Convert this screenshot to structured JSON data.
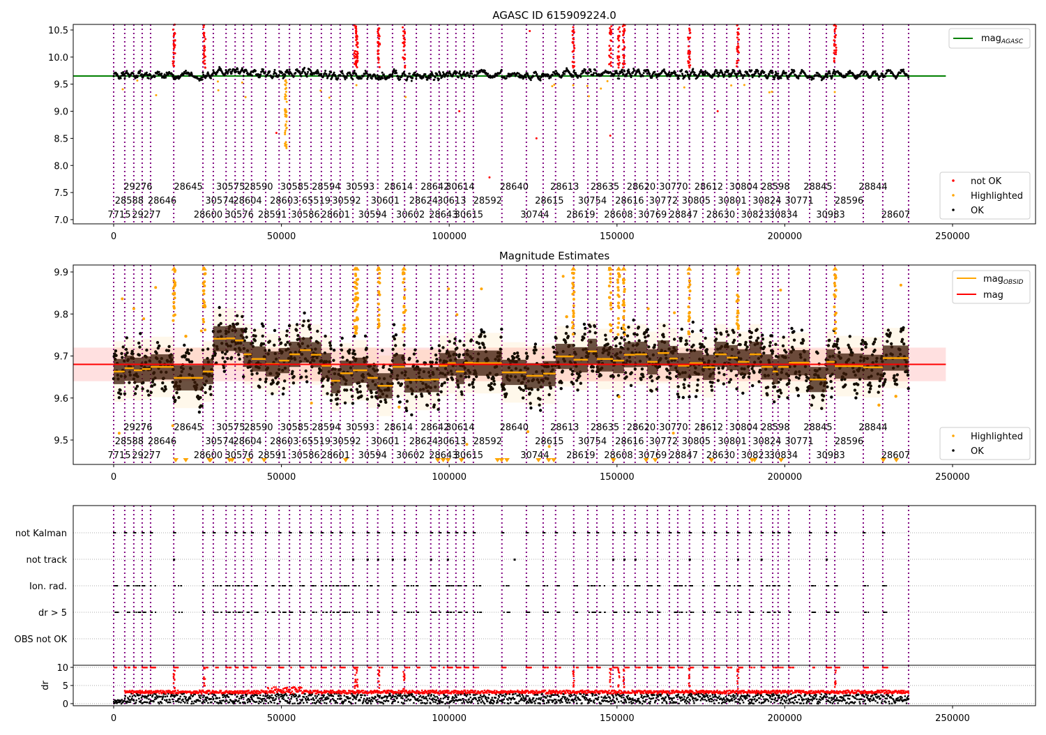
{
  "chart_data": {
    "type": "scatter",
    "titles": {
      "top": "AGASC ID 615909224.0",
      "middle": "Magnitude Estimates"
    },
    "xlim": [
      -12000,
      274700
    ],
    "xticks": [
      0,
      50000,
      100000,
      150000,
      200000,
      250000
    ],
    "obsids": [
      "7715",
      "28588",
      "29276",
      "29277",
      "28646",
      "28645",
      "28600",
      "30574",
      "30575",
      "30576",
      "28604",
      "28590",
      "28591",
      "28603",
      "30585",
      "30586",
      "65519",
      "28594",
      "28601",
      "30592",
      "30593",
      "30594",
      "30601",
      "28614",
      "30602",
      "28624",
      "28642",
      "28643",
      "30613",
      "30614",
      "30615",
      "28592",
      "28640",
      "30744",
      "28615",
      "28613",
      "28619",
      "30754",
      "28635",
      "28608",
      "28616",
      "28620",
      "30769",
      "30772",
      "30770",
      "28847",
      "30805",
      "28612",
      "28630",
      "30801",
      "30804",
      "30823",
      "30824",
      "28598",
      "30834",
      "30771",
      "28845",
      "30983",
      "28596",
      "28844",
      "28607"
    ],
    "obsid_start": [
      0,
      3300,
      6000,
      8500,
      11000,
      17900,
      26600,
      29700,
      33500,
      36200,
      38700,
      41100,
      45300,
      49300,
      52400,
      55500,
      58800,
      61900,
      64800,
      67500,
      71300,
      75600,
      78700,
      83100,
      86700,
      90200,
      94500,
      97000,
      99500,
      102000,
      104500,
      107200,
      115700,
      123000,
      128000,
      131700,
      137100,
      141300,
      144000,
      148800,
      152100,
      155400,
      159000,
      162100,
      165600,
      168100,
      171600,
      175600,
      179100,
      182700,
      186000,
      189500,
      193000,
      196400,
      198000,
      201200,
      207400,
      212400,
      214900,
      223400,
      229200
    ],
    "time_end": 236900,
    "mag_obsid": [
      9.663,
      9.671,
      9.666,
      9.669,
      9.674,
      9.648,
      9.663,
      9.741,
      9.742,
      9.737,
      9.704,
      9.693,
      9.681,
      9.689,
      9.704,
      9.714,
      9.703,
      9.677,
      9.641,
      9.659,
      9.666,
      9.648,
      9.629,
      9.674,
      9.643,
      9.643,
      9.644,
      9.677,
      9.683,
      9.663,
      9.684,
      9.683,
      9.661,
      9.653,
      9.658,
      9.699,
      9.691,
      9.711,
      9.693,
      9.689,
      9.703,
      9.704,
      9.686,
      9.707,
      9.694,
      9.677,
      9.683,
      9.673,
      9.704,
      9.696,
      9.686,
      9.704,
      9.674,
      9.663,
      9.674,
      9.684,
      9.644,
      9.686,
      9.676,
      9.673,
      9.695
    ],
    "mag_obsid_std": 0.04,
    "mag": 9.68,
    "mag_std": 0.04,
    "mag_agasc": 9.65,
    "not_ok_spike_times": [
      18000,
      27000,
      72000,
      72500,
      79000,
      86500,
      137000,
      148000,
      150500,
      152000,
      171500,
      186000,
      215000
    ],
    "not_track_times": [
      17900,
      71300,
      75600,
      78700,
      83100,
      86700,
      94500,
      99500,
      119400,
      148800,
      152100,
      155400,
      171600,
      186000,
      193000,
      212400
    ],
    "panel_top": {
      "ylim": [
        6.92,
        10.6
      ],
      "yticks": [
        "7.0",
        "7.5",
        "8.0",
        "8.5",
        "9.0",
        "9.5",
        "10.0",
        "10.5"
      ],
      "legend_line": {
        "label": "mag",
        "sub": "AGASC"
      },
      "legend_points": [
        "not OK",
        "Highlighted",
        "OK"
      ]
    },
    "panel_middle": {
      "ylim": [
        9.442,
        9.917
      ],
      "yticks": [
        "9.5",
        "9.6",
        "9.7",
        "9.8",
        "9.9"
      ],
      "legend_lines": [
        {
          "label": "mag",
          "sub": "OBSID"
        },
        {
          "label": "mag",
          "sub": ""
        }
      ],
      "legend_points": [
        "Highlighted",
        "OK"
      ]
    },
    "panel_flags": {
      "rows": [
        "not Kalman",
        "not track",
        "Ion. rad.",
        "dr > 5",
        "OBS not OK"
      ]
    },
    "panel_dr": {
      "ylabel": "dr",
      "ylim": [
        -0.6,
        10.6
      ],
      "yticks": [
        "0",
        "5",
        "10"
      ]
    },
    "colors": {
      "ok": "#000000",
      "highlighted": "#ffa500",
      "not_ok": "#ff0000",
      "agasc": "#008000",
      "obsid_line": "#800080",
      "mag_band": "#ffcccc"
    }
  }
}
